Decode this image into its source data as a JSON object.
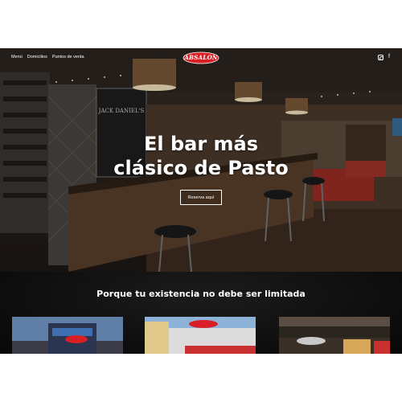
{
  "nav": {
    "items": [
      {
        "label": "Menú"
      },
      {
        "label": "Domicilios"
      },
      {
        "label": "Puntos de venta"
      }
    ]
  },
  "logo": {
    "text": "ABSALON"
  },
  "social": {
    "icons": [
      "instagram-icon",
      "facebook-icon"
    ],
    "facebook_glyph": "f"
  },
  "hero": {
    "headline_line1": "El bar más",
    "headline_line2": "clásico de Pasto",
    "cta_label": "Reserva aquí",
    "sign_text": "JACK DANIEL'S"
  },
  "section": {
    "tagline": "Porque tu existencia no debe ser limitada"
  },
  "colors": {
    "logo_red": "#d81f26",
    "site_dark": "#111111",
    "text_white": "#ffffff"
  }
}
